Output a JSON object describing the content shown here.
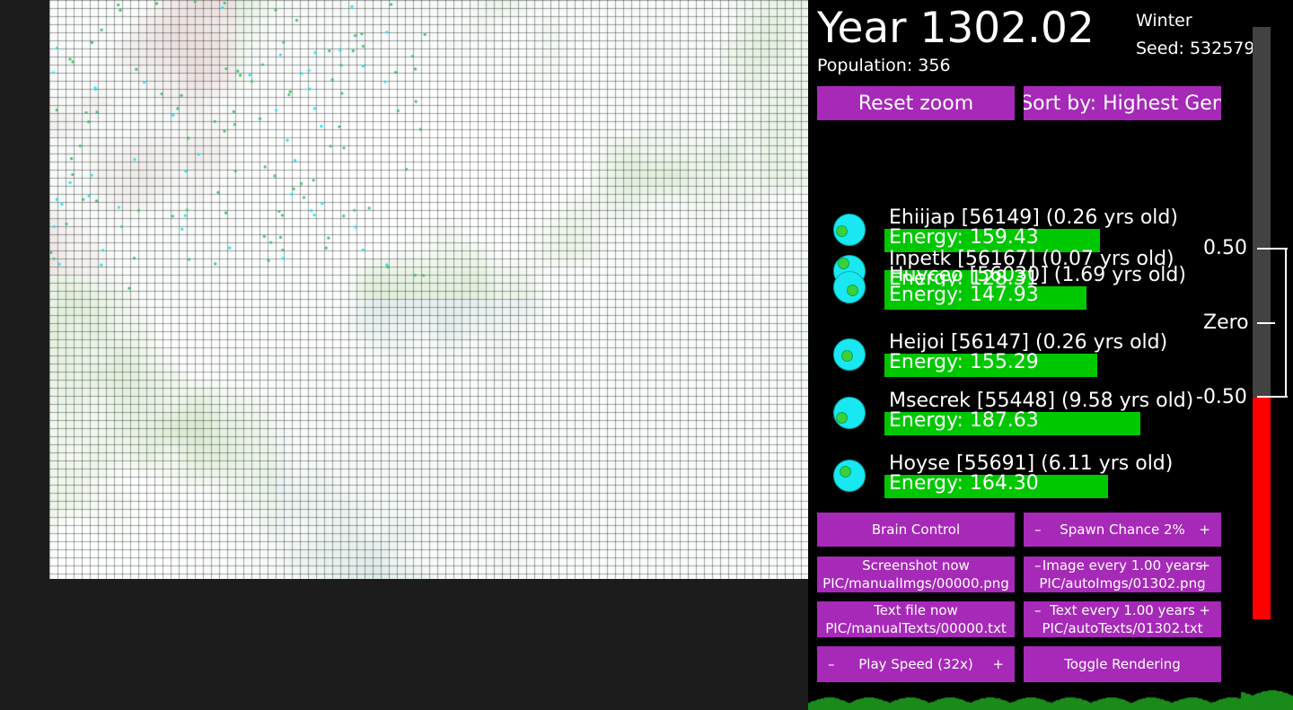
{
  "header": {
    "year": "Year 1302.02",
    "season": "Winter",
    "seed": "Seed: 532579",
    "population": "Population: 356"
  },
  "top_buttons": {
    "reset_zoom": "Reset zoom",
    "sort_by": "Sort by: Highest Gen"
  },
  "creatures": [
    {
      "name": "Ehiijap [56149] (0.26 yrs old)",
      "energy": "Energy: 159.43",
      "energy_fraction": 0.8
    },
    {
      "name": "Inpetk [56167] (0.07 yrs old)",
      "energy": "Energy: 128.31",
      "energy_fraction": 0.55
    },
    {
      "name": "Huyceo [56030] (1.69 yrs old)",
      "energy": "Energy: 147.93",
      "energy_fraction": 0.75
    },
    {
      "name": "Heijoi [56147] (0.26 yrs old)",
      "energy": "Energy: 155.29",
      "energy_fraction": 0.79
    },
    {
      "name": "Msecrek [55448] (9.58 yrs old)",
      "energy": "Energy: 187.63",
      "energy_fraction": 0.95
    },
    {
      "name": "Hoyse [55691] (6.11 yrs old)",
      "energy": "Energy: 164.30",
      "energy_fraction": 0.83
    }
  ],
  "controls": {
    "brain_control": "Brain Control",
    "spawn_chance": "Spawn Chance 2%",
    "screenshot_now": "Screenshot now",
    "screenshot_path": "PIC/manualImgs/00000.png",
    "image_every": "Image every 1.00 years",
    "image_path": "PIC/autoImgs/01302.png",
    "text_file_now": "Text file now",
    "text_file_path": "PIC/manualTexts/00000.txt",
    "text_every": "Text every 1.00 years",
    "text_path": "PIC/autoTexts/01302.txt",
    "play_speed": "Play Speed (32x)",
    "toggle_rendering": "Toggle Rendering",
    "minus": "–",
    "plus": "+"
  },
  "gauge": {
    "top_label": "0.50",
    "zero_label": "Zero",
    "bottom_label": "-0.50",
    "level_fraction": 0.375
  },
  "colors": {
    "button": "#a629b8",
    "energy_bar": "#00c800",
    "creature": "#19e8f2",
    "gauge_fill": "#ff0000"
  }
}
